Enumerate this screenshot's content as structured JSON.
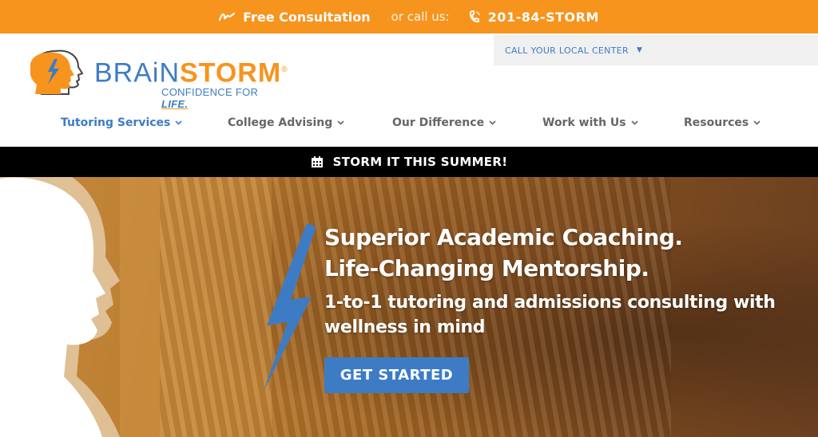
{
  "topbar": {
    "consult_icon": "signature-icon",
    "consult_label": "Free Consultation",
    "call_label": "or call us:",
    "phone_icon": "phone-icon",
    "phone_number": "201-84-STORM",
    "color": "#f7941e"
  },
  "logo": {
    "brand_part1": "BRAiN",
    "brand_part2": "STORM",
    "registered": "®",
    "tagline_part1": "CONFIDENCE FOR ",
    "tagline_part2": "LIFE."
  },
  "center_select": {
    "label": "CALL YOUR LOCAL CENTER"
  },
  "nav": {
    "items": [
      {
        "label": "Tutoring Services",
        "active": true
      },
      {
        "label": "College Advising",
        "active": false
      },
      {
        "label": "Our Difference",
        "active": false
      },
      {
        "label": "Work with Us",
        "active": false
      },
      {
        "label": "Resources",
        "active": false
      }
    ]
  },
  "promo": {
    "icon": "calendar-icon",
    "label": "STORM IT THIS SUMMER!"
  },
  "hero": {
    "title_line1": "Superior Academic Coaching.",
    "title_line2": "Life-Changing Mentorship.",
    "subtitle_line1": "1-to-1 tutoring and admissions consulting with",
    "subtitle_line2": "wellness in mind",
    "cta_label": "GET STARTED"
  },
  "colors": {
    "brand_blue": "#3d7cc4",
    "brand_orange": "#f7941e",
    "nav_gray": "#666666"
  }
}
